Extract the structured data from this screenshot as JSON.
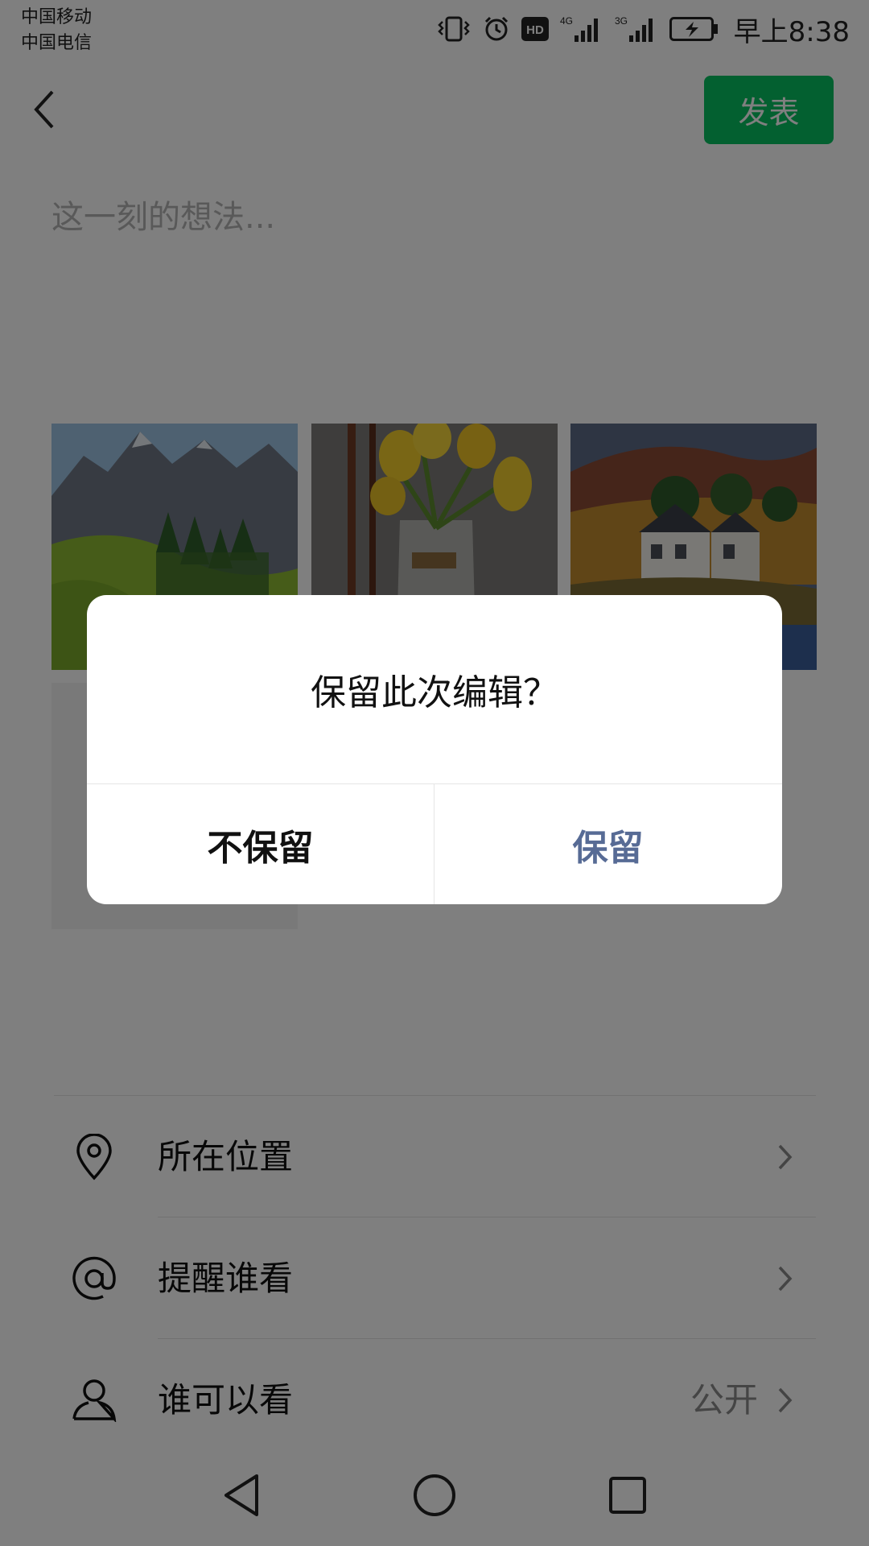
{
  "status_bar": {
    "carrier_1": "中国移动",
    "carrier_2": "中国电信",
    "network_1": "4G",
    "network_2": "3G",
    "hd_badge": "HD",
    "time": "早上8:38"
  },
  "header": {
    "back_icon": "chevron-left-icon",
    "publish_label": "发表",
    "publish_color": "#07C160"
  },
  "compose": {
    "placeholder": "这一刻的想法..."
  },
  "images": [
    {
      "name": "mountain-landscape-photo"
    },
    {
      "name": "yellow-tulips-vase-photo"
    },
    {
      "name": "white-house-hillside-photo"
    }
  ],
  "options": [
    {
      "icon": "location-pin-icon",
      "label": "所在位置",
      "value": ""
    },
    {
      "icon": "at-sign-icon",
      "label": "提醒谁看",
      "value": ""
    },
    {
      "icon": "person-icon",
      "label": "谁可以看",
      "value": "公开"
    }
  ],
  "dialog": {
    "message": "保留此次编辑？",
    "discard_label": "不保留",
    "keep_label": "保留",
    "keep_color": "#576B95"
  },
  "nav": {
    "back_icon": "triangle-back-icon",
    "home_icon": "circle-home-icon",
    "recent_icon": "square-recent-icon"
  }
}
